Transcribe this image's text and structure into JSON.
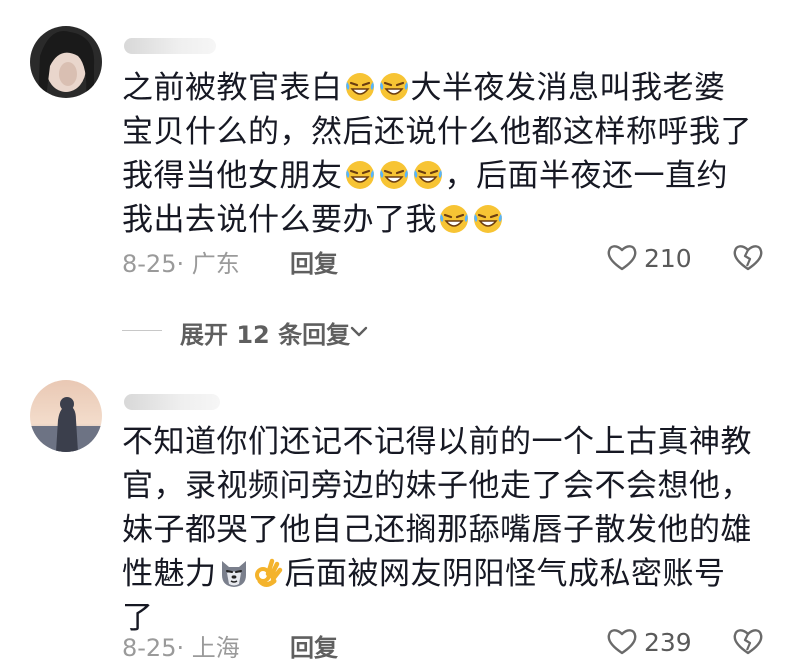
{
  "comments": [
    {
      "lines": [
        {
          "text": "之前被教官表白",
          "emojis_after": 2,
          "text2": "大半夜发消息叫我老婆"
        },
        {
          "text": "宝贝什么的，然后还说什么他都这样称呼我了"
        },
        {
          "text": "我得当他女朋友",
          "emojis_after": 3,
          "text2": "，后面半夜还一直约"
        },
        {
          "text": "我出去说什么要办了我",
          "emojis_after": 2
        }
      ],
      "date_location": "8-25· 广东",
      "reply_label": "回复",
      "likes": "210",
      "emoji": "laughing-tears-emoji"
    },
    {
      "lines": [
        {
          "text": "不知道你们还记不记得以前的一个上古真神教"
        },
        {
          "text": "官，录视频问旁边的妹子他走了会不会想他，"
        },
        {
          "text": "妹子都哭了他自己还搁那舔嘴唇子散发他的雄"
        },
        {
          "text": "性魅力",
          "special_emojis": [
            "wolf-emoji",
            "ok-hand-emoji"
          ],
          "text2": "后面被网友阴阳怪气成私密账号"
        },
        {
          "text": "了"
        }
      ],
      "date_location": "8-25· 上海",
      "reply_label": "回复",
      "likes": "239"
    }
  ],
  "expand_replies_label": "展开 12 条回复",
  "colors": {
    "text": "#161823",
    "meta": "#9a9a9a",
    "reply": "#5f5f5f"
  }
}
